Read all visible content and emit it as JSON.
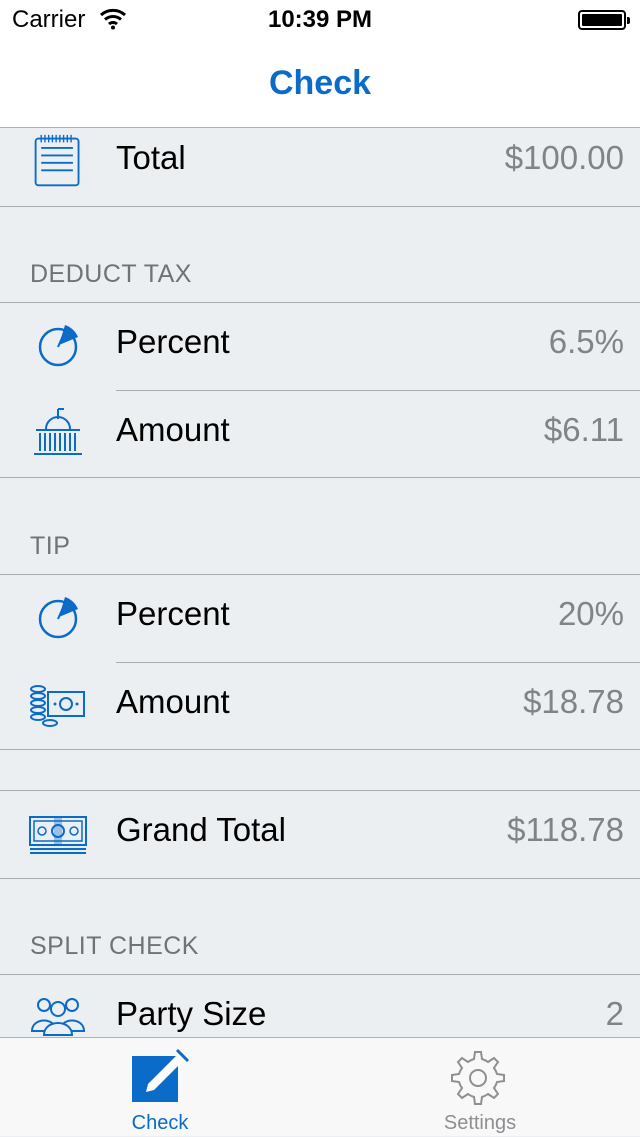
{
  "status_bar": {
    "carrier": "Carrier",
    "time": "10:39 PM"
  },
  "navbar": {
    "title": "Check"
  },
  "total": {
    "label": "Total",
    "value": "$100.00",
    "icon": "receipt-icon"
  },
  "deduct_tax": {
    "header": "DEDUCT TAX",
    "percent": {
      "label": "Percent",
      "value": "6.5%",
      "icon": "pie-chart-icon"
    },
    "amount": {
      "label": "Amount",
      "value": "$6.11",
      "icon": "government-building-icon"
    }
  },
  "tip": {
    "header": "TIP",
    "percent": {
      "label": "Percent",
      "value": "20%",
      "icon": "pie-chart-icon"
    },
    "amount": {
      "label": "Amount",
      "value": "$18.78",
      "icon": "coins-bill-icon"
    }
  },
  "grand_total": {
    "label": "Grand Total",
    "value": "$118.78",
    "icon": "cash-stack-icon"
  },
  "split_check": {
    "header": "SPLIT CHECK",
    "party_size": {
      "label": "Party Size",
      "value": "2",
      "icon": "people-icon"
    }
  },
  "tabbar": {
    "tabs": [
      {
        "label": "Check",
        "icon": "pencil-edit-icon",
        "selected": true
      },
      {
        "label": "Settings",
        "icon": "gear-icon",
        "selected": false
      }
    ]
  },
  "colors": {
    "accent": "#0a6bc9",
    "background": "#eceff1",
    "value_text": "#808487",
    "header_text": "#6f7376"
  }
}
